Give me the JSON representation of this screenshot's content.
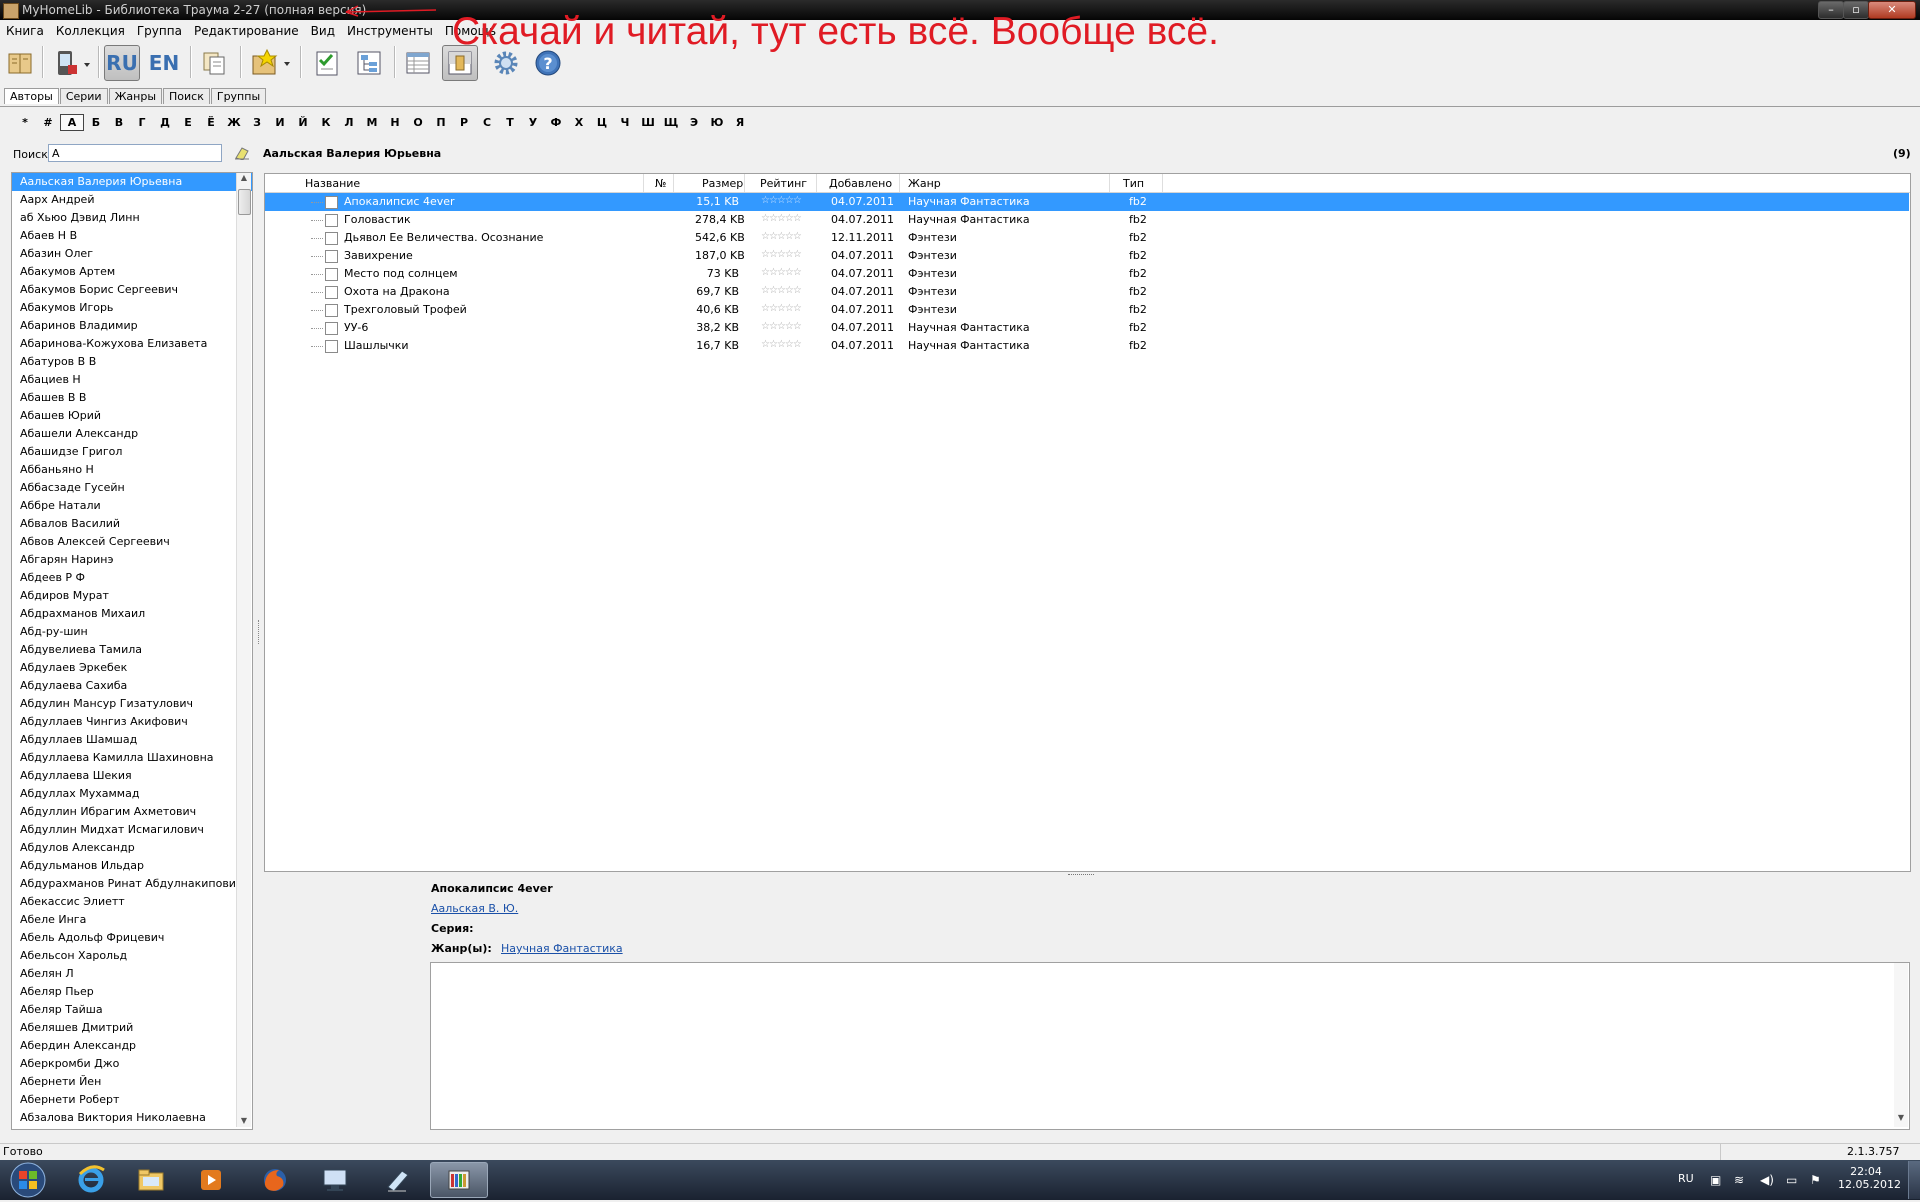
{
  "window": {
    "title": "MyHomeLib - Библиотека Траума 2-27 (полная версия)"
  },
  "overlay_text": "Скачай и читай, тут есть всё. Вообще всё.",
  "menu": [
    "Книга",
    "Коллекция",
    "Группа",
    "Редактирование",
    "Вид",
    "Инструменты",
    "Помощь"
  ],
  "toolbar": {
    "buttons": [
      "library-icon",
      "device-icon",
      "ru-icon",
      "en-icon",
      "copy-icon",
      "add-icon",
      "checklist-icon",
      "tree-icon",
      "table-icon",
      "preview-icon",
      "settings-icon",
      "help-icon"
    ],
    "ru_label": "RU",
    "en_label": "EN"
  },
  "tabs": [
    "Авторы",
    "Серии",
    "Жанры",
    "Поиск",
    "Группы"
  ],
  "letters": [
    "*",
    "#",
    "А",
    "Б",
    "В",
    "Г",
    "Д",
    "Е",
    "Ё",
    "Ж",
    "З",
    "И",
    "Й",
    "К",
    "Л",
    "М",
    "Н",
    "О",
    "П",
    "Р",
    "С",
    "Т",
    "У",
    "Ф",
    "Х",
    "Ц",
    "Ч",
    "Ш",
    "Щ",
    "Э",
    "Ю",
    "Я"
  ],
  "selected_letter": "А",
  "search": {
    "label": "Поиск",
    "value": "А"
  },
  "authors": [
    "Аальская Валерия Юрьевна",
    "Аарх Андрей",
    "аб Хьюо Дэвид Линн",
    "Абаев Н В",
    "Абазин Олег",
    "Абакумов Артем",
    "Абакумов Борис Сергеевич",
    "Абакумов Игорь",
    "Абаринов Владимир",
    "Абаринова-Кожухова Елизавета",
    "Абатуров В В",
    "Абациев Н",
    "Абашев В В",
    "Абашев Юрий",
    "Абашели Александр",
    "Абашидзе Григол",
    "Аббаньяно Н",
    "Аббасзаде Гусейн",
    "Аббре Натали",
    "Абвалов Василий",
    "Абвов Алексей Сергеевич",
    "Абгарян Наринэ",
    "Абдеев Р Ф",
    "Абдиров Мурат",
    "Абдрахманов Михаил",
    "Абд-ру-шин",
    "Абдувелиева Тамила",
    "Абдулаев Эркебек",
    "Абдулаева Сахиба",
    "Абдулин Мансур Гизатулович",
    "Абдуллаев Чингиз Акифович",
    "Абдуллаев Шамшад",
    "Абдуллаева Камилла Шахиновна",
    "Абдуллаева Шекия",
    "Абдуллах Мухаммад",
    "Абдуллин Ибрагим Ахметович",
    "Абдуллин Мидхат Исмагилович",
    "Абдулов Александр",
    "Абдульманов Ильдар",
    "Абдурахманов Ринат Абдулнакипович",
    "Абекассис Элиетт",
    "Абеле Инга",
    "Абель Адольф Фрицевич",
    "Абельсон Харольд",
    "Абелян Л",
    "Абеляр Пьер",
    "Абеляр Тайша",
    "Абеляшев Дмитрий",
    "Абердин Александр",
    "Аберкромби Джо",
    "Абернети Йен",
    "Абернети Роберт",
    "Абзалова Виктория Николаевна"
  ],
  "selected_author": "Аальская Валерия Юрьевна",
  "book_count": "(9)",
  "columns": [
    "Название",
    "№",
    "Размер",
    "Рейтинг",
    "Добавлено",
    "Жанр",
    "Тип"
  ],
  "books": [
    {
      "title": "Апокалипсис 4ever",
      "size": "15,1 KB",
      "rating": "☆☆☆☆☆",
      "added": "04.07.2011",
      "genre": "Научная Фантастика",
      "type": "fb2"
    },
    {
      "title": "Головастик",
      "size": "278,4 KB",
      "rating": "☆☆☆☆☆",
      "added": "04.07.2011",
      "genre": "Научная Фантастика",
      "type": "fb2"
    },
    {
      "title": "Дьявол Ее Величества. Осознание",
      "size": "542,6 KB",
      "rating": "☆☆☆☆☆",
      "added": "12.11.2011",
      "genre": "Фэнтези",
      "type": "fb2"
    },
    {
      "title": "Завихрение",
      "size": "187,0 KB",
      "rating": "☆☆☆☆☆",
      "added": "04.07.2011",
      "genre": "Фэнтези",
      "type": "fb2"
    },
    {
      "title": "Место под солнцем",
      "size": "73 KB",
      "rating": "☆☆☆☆☆",
      "added": "04.07.2011",
      "genre": "Фэнтези",
      "type": "fb2"
    },
    {
      "title": "Охота на Дракона",
      "size": "69,7 KB",
      "rating": "☆☆☆☆☆",
      "added": "04.07.2011",
      "genre": "Фэнтези",
      "type": "fb2"
    },
    {
      "title": "Трехголовый Трофей",
      "size": "40,6 KB",
      "rating": "☆☆☆☆☆",
      "added": "04.07.2011",
      "genre": "Фэнтези",
      "type": "fb2"
    },
    {
      "title": "УУ-6",
      "size": "38,2 KB",
      "rating": "☆☆☆☆☆",
      "added": "04.07.2011",
      "genre": "Научная Фантастика",
      "type": "fb2"
    },
    {
      "title": "Шашлычки",
      "size": "16,7 KB",
      "rating": "☆☆☆☆☆",
      "added": "04.07.2011",
      "genre": "Научная Фантастика",
      "type": "fb2"
    }
  ],
  "details": {
    "title": "Апокалипсис 4ever",
    "author": "Аальская В. Ю.",
    "series_label": "Серия:",
    "genre_label": "Жанр(ы):",
    "genre": "Научная Фантастика"
  },
  "status": {
    "text": "Готово",
    "version": "2.1.3.757"
  },
  "taskbar": {
    "apps": [
      "ie-icon",
      "explorer-icon",
      "media-player-icon",
      "firefox-icon",
      "remote-desktop-icon",
      "notepad-icon",
      "myhomelib-icon"
    ],
    "lang": "RU",
    "time": "22:04",
    "date": "12.05.2012"
  },
  "colors": {
    "selection": "#3399ff",
    "overlay": "#e01b24",
    "link": "#1a50a8"
  }
}
